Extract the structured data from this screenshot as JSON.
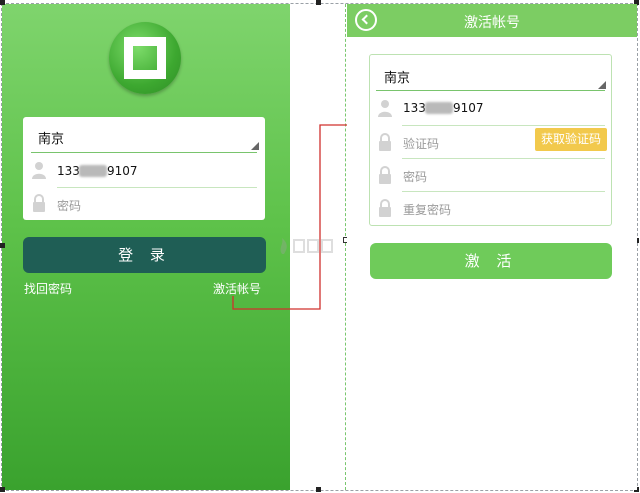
{
  "login": {
    "city": "南京",
    "phone_prefix": "133",
    "phone_suffix": "9107",
    "password_placeholder": "密码",
    "login_button": "登 录",
    "forgot_password_link": "找回密码",
    "activate_account_link": "激活帐号"
  },
  "activate": {
    "title": "激活帐号",
    "city": "南京",
    "phone_prefix": "133",
    "phone_suffix": "9107",
    "verification_placeholder": "验证码",
    "get_code_button": "获取验证码",
    "password_placeholder": "密码",
    "repeat_password_placeholder": "重复密码",
    "activate_button": "激 活"
  },
  "colors": {
    "login_bg_top": "#7fd46d",
    "login_bg_bottom": "#3aa22e",
    "login_button": "#1f5e55",
    "topbar": "#7ccd63",
    "activate_button": "#6fcb5a",
    "get_code_button": "#f2c94c",
    "arrow": "#d0302c"
  },
  "icons": {
    "logo": "app-logo-icon",
    "user": "user-icon",
    "lock": "lock-icon",
    "back": "back-icon",
    "dropdown": "dropdown-corner-icon"
  }
}
